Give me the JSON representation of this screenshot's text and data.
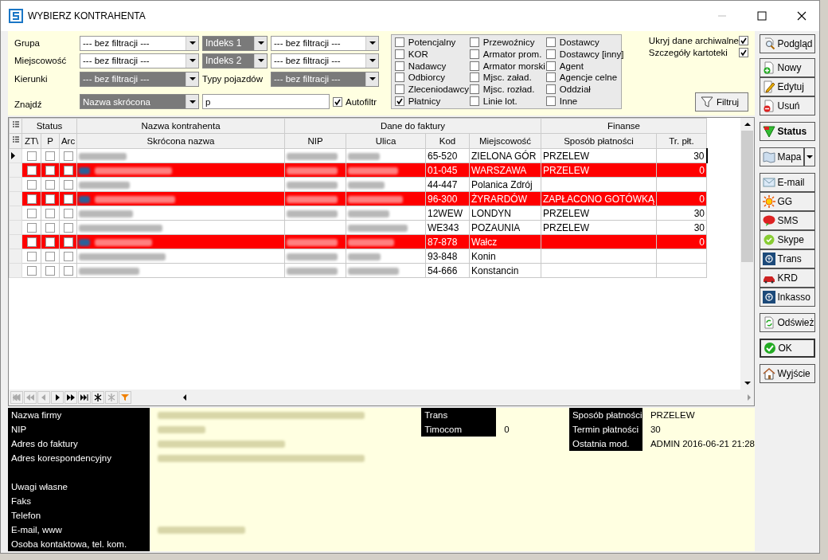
{
  "window": {
    "title": "WYBIERZ KONTRAHENTA"
  },
  "filters": {
    "rows": [
      {
        "label": "Grupa",
        "value": "--- bez filtracji ---",
        "disabled": false,
        "index_label": "Indeks 1",
        "index_value": "--- bez filtracji ---",
        "index_disabled": false
      },
      {
        "label": "Miejscowość",
        "value": "--- bez filtracji ---",
        "disabled": false,
        "index_label": "Indeks 2",
        "index_value": "--- bez filtracji ---",
        "index_disabled": false
      },
      {
        "label": "Kierunki",
        "value": "--- bez filtracji ---",
        "disabled": true,
        "index_label": "Typy pojazdów",
        "index_value": "--- bez filtracji ---",
        "index_disabled": true
      }
    ],
    "find": {
      "label": "Znajdź",
      "mode": "Nazwa skrócona",
      "value": "p",
      "autofilter": {
        "label": "Autofiltr",
        "checked": true
      }
    }
  },
  "types": [
    {
      "label": "Potencjalny",
      "checked": false
    },
    {
      "label": "KOR",
      "checked": false
    },
    {
      "label": "Nadawcy",
      "checked": false
    },
    {
      "label": "Odbiorcy",
      "checked": false
    },
    {
      "label": "Zleceniodawcy",
      "checked": false
    },
    {
      "label": "Płatnicy",
      "checked": true
    },
    {
      "label": "Przewoźnicy",
      "checked": false
    },
    {
      "label": "Armator prom.",
      "checked": false
    },
    {
      "label": "Armator morski",
      "checked": false
    },
    {
      "label": "Mjsc. załad.",
      "checked": false
    },
    {
      "label": "Mjsc. rozład.",
      "checked": false
    },
    {
      "label": "Linie lot.",
      "checked": false
    },
    {
      "label": "Dostawcy",
      "checked": false
    },
    {
      "label": "Dostawcy [inny]",
      "checked": false
    },
    {
      "label": "Agent",
      "checked": false
    },
    {
      "label": "Agencje celne",
      "checked": false
    },
    {
      "label": "Oddział",
      "checked": false
    },
    {
      "label": "Inne",
      "checked": false
    }
  ],
  "options": [
    {
      "label": "Ukryj dane archiwalne",
      "checked": true
    },
    {
      "label": "Szczegóły kartoteki",
      "checked": true
    }
  ],
  "filter_button": "Filtruj",
  "table": {
    "groups": [
      "Status",
      "Nazwa kontrahenta",
      "Dane do faktury",
      "Finanse"
    ],
    "columns": [
      "ZT\\",
      "P",
      "Arc",
      "Skrócona nazwa",
      "NIP",
      "Ulica",
      "Kod",
      "Miejscowość",
      "Sposób płatności",
      "Tr. płt."
    ],
    "rows": [
      {
        "current": true,
        "highlighted": false,
        "zt": false,
        "p": false,
        "arc": false,
        "kod": "65-520",
        "miejscowosc": "ZIELONA GÓR",
        "sposob": "PRZELEW",
        "termin": "30"
      },
      {
        "current": false,
        "highlighted": true,
        "zt": false,
        "p": false,
        "arc": false,
        "kod": "01-045",
        "miejscowosc": "WARSZAWA",
        "sposob": "PRZELEW",
        "termin": "0"
      },
      {
        "current": false,
        "highlighted": false,
        "zt": false,
        "p": false,
        "arc": false,
        "kod": "44-447",
        "miejscowosc": "Polanica Zdrój"
      },
      {
        "current": false,
        "highlighted": true,
        "zt": false,
        "p": false,
        "arc": false,
        "kod": "96-300",
        "miejscowosc": "ŻYRARDÓW",
        "sposob": "ZAPŁACONO GOTÓWKĄ",
        "termin": "0"
      },
      {
        "current": false,
        "highlighted": false,
        "zt": false,
        "p": false,
        "arc": false,
        "kod": "12WEW",
        "miejscowosc": "LONDYN",
        "sposob": "PRZELEW",
        "termin": "30"
      },
      {
        "current": false,
        "highlighted": false,
        "zt": false,
        "p": false,
        "arc": false,
        "kod": "WE343",
        "miejscowosc": "POZAUNIA",
        "sposob": "PRZELEW",
        "termin": "30"
      },
      {
        "current": false,
        "highlighted": true,
        "zt": false,
        "p": false,
        "arc": false,
        "kod": "87-878",
        "miejscowosc": "Wałcz",
        "termin": "0"
      },
      {
        "current": false,
        "highlighted": false,
        "zt": false,
        "p": false,
        "arc": false,
        "kod": "93-848",
        "miejscowosc": "Konin"
      },
      {
        "current": false,
        "highlighted": false,
        "zt": false,
        "p": false,
        "arc": false,
        "kod": "54-666",
        "miejscowosc": "Konstancin"
      }
    ]
  },
  "side_buttons": [
    {
      "label": "Podgląd",
      "kind": "preview"
    },
    {
      "label": "Nowy",
      "kind": "new"
    },
    {
      "label": "Edytuj",
      "kind": "edit"
    },
    {
      "label": "Usuń",
      "kind": "delete"
    },
    {
      "label": "Status",
      "kind": "status"
    },
    {
      "label": "Mapa",
      "kind": "map"
    },
    {
      "label": "E-mail",
      "kind": "mail"
    },
    {
      "label": "GG",
      "kind": "gg"
    },
    {
      "label": "SMS",
      "kind": "sms"
    },
    {
      "label": "Skype",
      "kind": "skype"
    },
    {
      "label": "Trans",
      "kind": "trans"
    },
    {
      "label": "KRD",
      "kind": "krd"
    },
    {
      "label": "Inkasso",
      "kind": "trans"
    },
    {
      "label": "Odśwież",
      "kind": "refresh"
    },
    {
      "label": "OK",
      "kind": "ok"
    },
    {
      "label": "Wyjście",
      "kind": "exit"
    }
  ],
  "details": {
    "left_top": [
      "Nazwa firmy",
      "NIP",
      "Adres do faktury",
      "Adres korespondencyjny"
    ],
    "left_bottom": [
      "Uwagi własne",
      "Faks",
      "Telefon",
      "E-mail, www",
      "Osoba kontaktowa, tel. kom."
    ],
    "middle": [
      {
        "label": "Trans"
      },
      {
        "label": "Timocom",
        "value": "0"
      }
    ],
    "right": [
      {
        "label": "Sposób płatności",
        "value": "PRZELEW"
      },
      {
        "label": "Termin płatności",
        "value": "30"
      },
      {
        "label": "Ostatnia mod.",
        "value": "ADMIN 2016-06-21 21:28"
      }
    ]
  }
}
